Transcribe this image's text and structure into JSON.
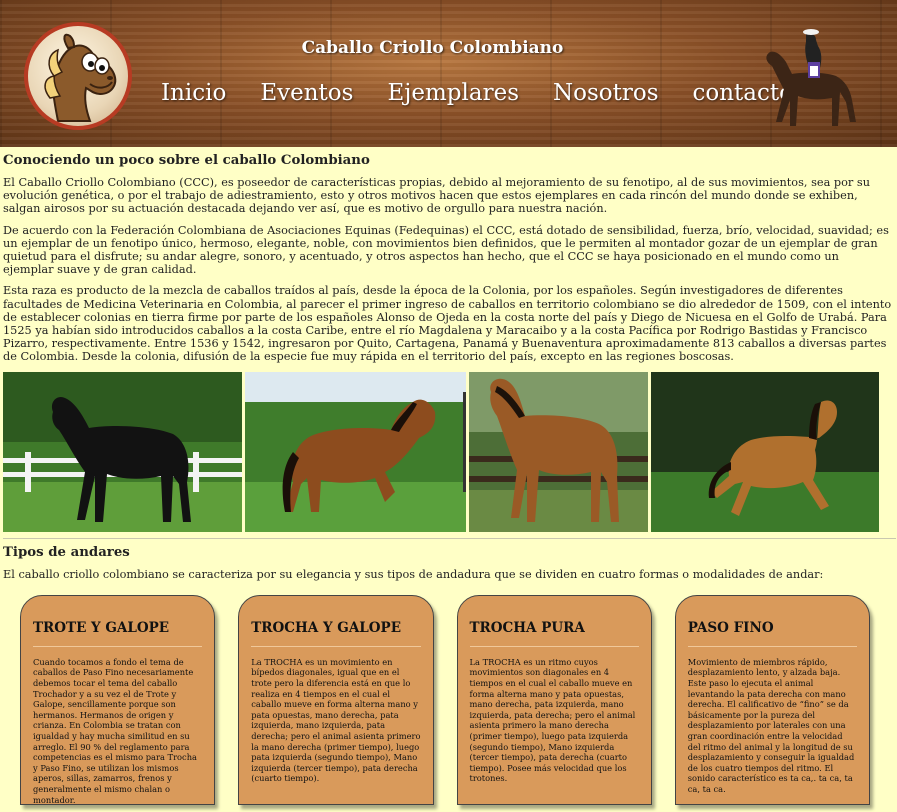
{
  "header": {
    "title": "Caballo Criollo Colombiano",
    "nav": [
      {
        "label": "Inicio"
      },
      {
        "label": "Eventos"
      },
      {
        "label": "Ejemplares"
      },
      {
        "label": "Nosotros"
      },
      {
        "label": "contacto"
      }
    ]
  },
  "intro": {
    "heading": "Conociendo un poco sobre el caballo Colombiano",
    "paragraphs": [
      "El Caballo Criollo Colombiano (CCC), es poseedor de características propias, debido al mejoramiento de su fenotipo, al de sus movimientos, sea por su evolución genética, o por el trabajo de adiestramiento, esto y otros motivos hacen que estos ejemplares en cada rincón del mundo donde se exhiben, salgan airosos por su actuación destacada dejando ver así, que es motivo de orgullo para nuestra nación.",
      "De acuerdo con la Federación Colombiana de Asociaciones Equinas (Fedequinas) el CCC, está dotado de sensibilidad, fuerza, brío, velocidad, suavidad; es un ejemplar de un fenotipo único, hermoso, elegante, noble, con movimientos bien definidos, que le permiten al montador gozar de un ejemplar de gran quietud para el disfrute; su andar alegre, sonoro, y acentuado, y otros aspectos han hecho, que el CCC se haya posicionado en el mundo como un ejemplar suave y de gran calidad.",
      "Esta raza es producto de la mezcla de caballos traídos al país, desde la época de la Colonia, por los españoles. Según investigadores de diferentes facultades de Medicina Veterinaria en Colombia, al parecer el primer ingreso de caballos en territorio colombiano se dio alrededor de 1509, con el intento de establecer colonias en tierra firme por parte de los españoles Alonso de Ojeda en la costa norte del país y Diego de Nicuesa en el Golfo de Urabá. Para 1525 ya habían sido introducidos caballos a la costa Caribe, entre el río Magdalena y Maracaibo y a la costa Pacífica por Rodrigo Bastidas y Francisco Pizarro, respectivamente. Entre 1536 y 1542, ingresaron por Quito, Cartagena, Panamá y Buenaventura aproximadamente 813 caballos a diversas partes de Colombia. Desde la colonia, difusión de la especie fue muy rápida en el territorio del país, excepto en las regiones boscosas."
    ]
  },
  "andares": {
    "heading": "Tipos de andares",
    "intro": "El caballo criollo colombiano se caracteriza por su elegancia y sus tipos de andadura que se dividen en cuatro formas o modalidades de andar:",
    "cards": [
      {
        "title": "TROTE Y GALOPE",
        "text": "Cuando tocamos a fondo el tema de caballos de Paso Fino necesariamente debemos tocar el tema del caballo Trochador y a su vez el de Trote y Galope, sencillamente porque son hermanos. Hermanos de origen y crianza. En Colombia se tratan con igualdad y hay mucha similitud en su arreglo. El 90 % del reglamento para competencias es el mismo para Trocha y Paso Fino, se utilizan los mismos aperos, sillas, zamarros, frenos y generalmente el mismo chalan o montador."
      },
      {
        "title": "TROCHA Y GALOPE",
        "text": "La TROCHA es un movimiento en bípedos diagonales, igual que en el trote pero la diferencia está en que lo realiza en 4 tiempos en el cual el caballo mueve en forma alterna mano y pata opuestas, mano derecha, pata izquierda, mano izquierda, pata derecha; pero el animal asienta primero la mano derecha (primer tiempo), luego pata izquierda (segundo tiempo), Mano izquierda (tercer tiempo), pata derecha (cuarto tiempo)."
      },
      {
        "title": "TROCHA PURA",
        "text": "La TROCHA es un ritmo cuyos movimientos son diagonales en 4 tiempos en el cual el caballo mueve en forma alterna mano y pata opuestas, mano derecha, pata izquierda, mano izquierda, pata derecha; pero el animal asienta primero la mano derecha (primer tiempo), luego pata izquierda (segundo tiempo), Mano izquierda (tercer tiempo), pata derecha (cuarto tiempo). Posee más velocidad que los trotones."
      },
      {
        "title": "PASO FINO",
        "text": "Movimiento de miembros rápido, desplazamiento lento, y alzada baja. Este paso lo ejecuta el animal levantando la pata derecha con mano derecha. El calificativo de “fino” se da básicamente por la pureza del desplazamiento por laterales con una gran coordinación entre la velocidad del ritmo del animal y la longitud de su desplazamiento y conseguir la igualdad de los cuatro tiempos del ritmo. El sonido característico es ta ca,. ta ca, ta ca, ta ca."
      }
    ]
  }
}
